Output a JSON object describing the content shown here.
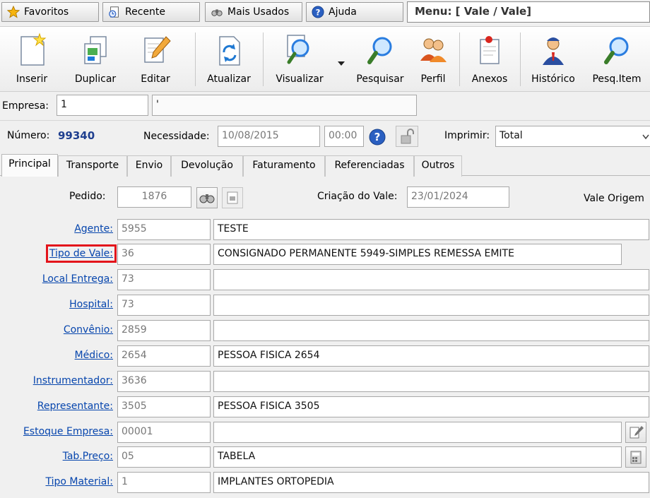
{
  "top": {
    "favoritos": "Favoritos",
    "recente": "Recente",
    "mais_usados": "Mais Usados",
    "ajuda": "Ajuda",
    "menu_title": "Menu: [ Vale / Vale]"
  },
  "toolbar": {
    "inserir": "Inserir",
    "duplicar": "Duplicar",
    "editar": "Editar",
    "atualizar": "Atualizar",
    "visualizar": "Visualizar",
    "pesquisar": "Pesquisar",
    "perfil": "Perfil",
    "anexos": "Anexos",
    "historico": "Histórico",
    "pesq_item": "Pesq.Item"
  },
  "empresa": {
    "label": "Empresa:",
    "value": "1",
    "name": "'"
  },
  "header": {
    "numero_label": "Número:",
    "numero_value": "99340",
    "necessidade_label": "Necessidade:",
    "necessidade_date": "10/08/2015",
    "necessidade_time": "00:00",
    "imprimir_label": "Imprimir:",
    "imprimir_value": "Total"
  },
  "tabs": [
    "Principal",
    "Transporte",
    "Envio",
    "Devolução",
    "Faturamento",
    "Referenciadas",
    "Outros"
  ],
  "pedido": {
    "label": "Pedido:",
    "value": "1876",
    "criacao_label": "Criação do Vale:",
    "criacao_value": "23/01/2024",
    "vale_origem": "Vale Origem"
  },
  "fields": [
    {
      "label": "Agente:",
      "code": "5955",
      "desc": "TESTE"
    },
    {
      "label": "Tipo de Vale:",
      "code": "36",
      "desc": "CONSIGNADO PERMANENTE 5949-SIMPLES REMESSA EMITE"
    },
    {
      "label": "Local Entrega:",
      "code": "73",
      "desc": ""
    },
    {
      "label": "Hospital:",
      "code": "73",
      "desc": ""
    },
    {
      "label": "Convênio:",
      "code": "2859",
      "desc": ""
    },
    {
      "label": "Médico:",
      "code": "2654",
      "desc": "PESSOA FISICA 2654"
    },
    {
      "label": "Instrumentador:",
      "code": "3636",
      "desc": ""
    },
    {
      "label": "Representante:",
      "code": "3505",
      "desc": "PESSOA FISICA 3505"
    },
    {
      "label": "Estoque Empresa:",
      "code": "00001",
      "desc": ""
    },
    {
      "label": "Tab.Preço:",
      "code": "05",
      "desc": "TABELA"
    },
    {
      "label": "Tipo Material:",
      "code": "1",
      "desc": "IMPLANTES ORTOPEDIA"
    }
  ],
  "colors": {
    "link": "#0645ad",
    "highlight": "#e3141b",
    "number": "#1f3f8f"
  }
}
